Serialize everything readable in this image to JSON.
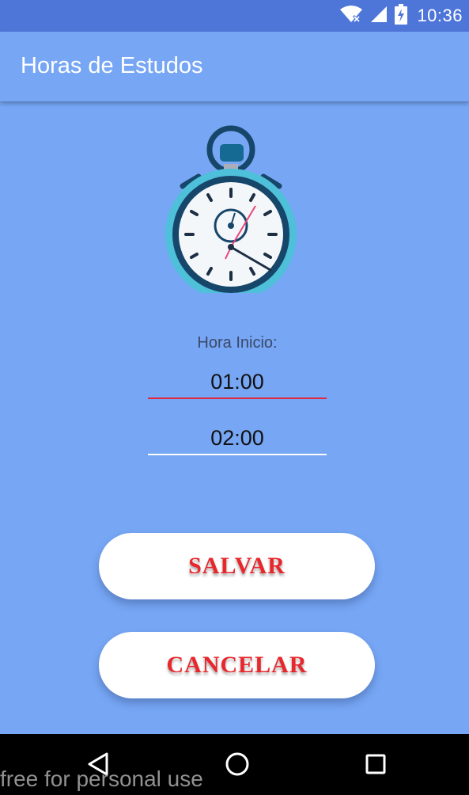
{
  "status_bar": {
    "time": "10:36",
    "icons": [
      "wifi-icon",
      "signal-icon",
      "battery-charging-icon"
    ]
  },
  "app_bar": {
    "title": "Horas de Estudos"
  },
  "illustration": {
    "icon": "stopwatch-icon"
  },
  "form": {
    "start_label": "Hora Inicio:",
    "start_value": "01:00",
    "end_value": "02:00"
  },
  "buttons": {
    "save_label": "SALVAR",
    "cancel_label": "CANCELAR"
  },
  "nav_bar": {
    "icons": [
      "back-icon",
      "home-icon",
      "recent-apps-icon"
    ]
  },
  "watermark": "free for personal use",
  "colors": {
    "status_bar": "#4e76d9",
    "background": "#76a6f4",
    "accent_red": "#e8272c",
    "underline_active": "#e0283a",
    "button_bg": "#ffffff"
  }
}
